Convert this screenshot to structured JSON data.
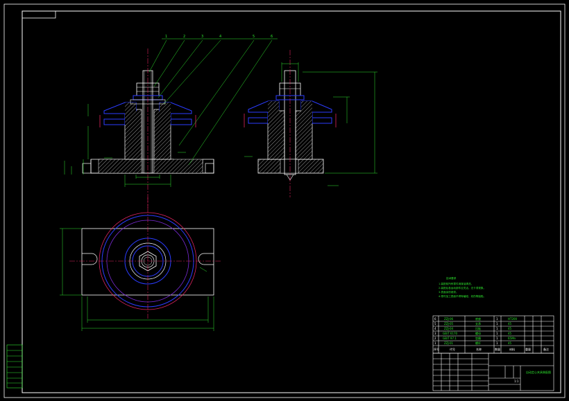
{
  "balloons": [
    "1",
    "2",
    "3",
    "4",
    "5",
    "6"
  ],
  "tech_notes": {
    "title": "技术要求",
    "lines": [
      "1.装配前所有零件用煤油清洗。",
      "2.装配后各运动部件应灵活，无卡滞现象。",
      "3.表面涂防锈漆。",
      "4.零件加工表面不得有磕碰、划伤等缺陷。"
    ]
  },
  "parts_list": [
    {
      "no": "6",
      "code": "ZZJ-06",
      "name": "底座",
      "qty": "1",
      "mat": "HT200"
    },
    {
      "no": "5",
      "code": "ZZJ-05",
      "name": "支承",
      "qty": "1",
      "mat": "45"
    },
    {
      "no": "4",
      "code": "ZZJ-04",
      "name": "压板",
      "qty": "1",
      "mat": "45"
    },
    {
      "no": "3",
      "code": "GB/T 6170",
      "name": "螺母",
      "qty": "1",
      "mat": "45"
    },
    {
      "no": "2",
      "code": "GB/T 97.1",
      "name": "垫圈",
      "qty": "1",
      "mat": "65Mn"
    },
    {
      "no": "1",
      "code": "ZZJ-01",
      "name": "螺杆",
      "qty": "1",
      "mat": "45"
    }
  ],
  "parts_header": {
    "no": "序号",
    "code": "代号",
    "name": "名称",
    "qty": "数量",
    "mat": "材料",
    "weight": "重量",
    "note": "备注"
  },
  "title_block": {
    "drawing_name": "自动定心夹具装配图",
    "scale": "1:1"
  }
}
